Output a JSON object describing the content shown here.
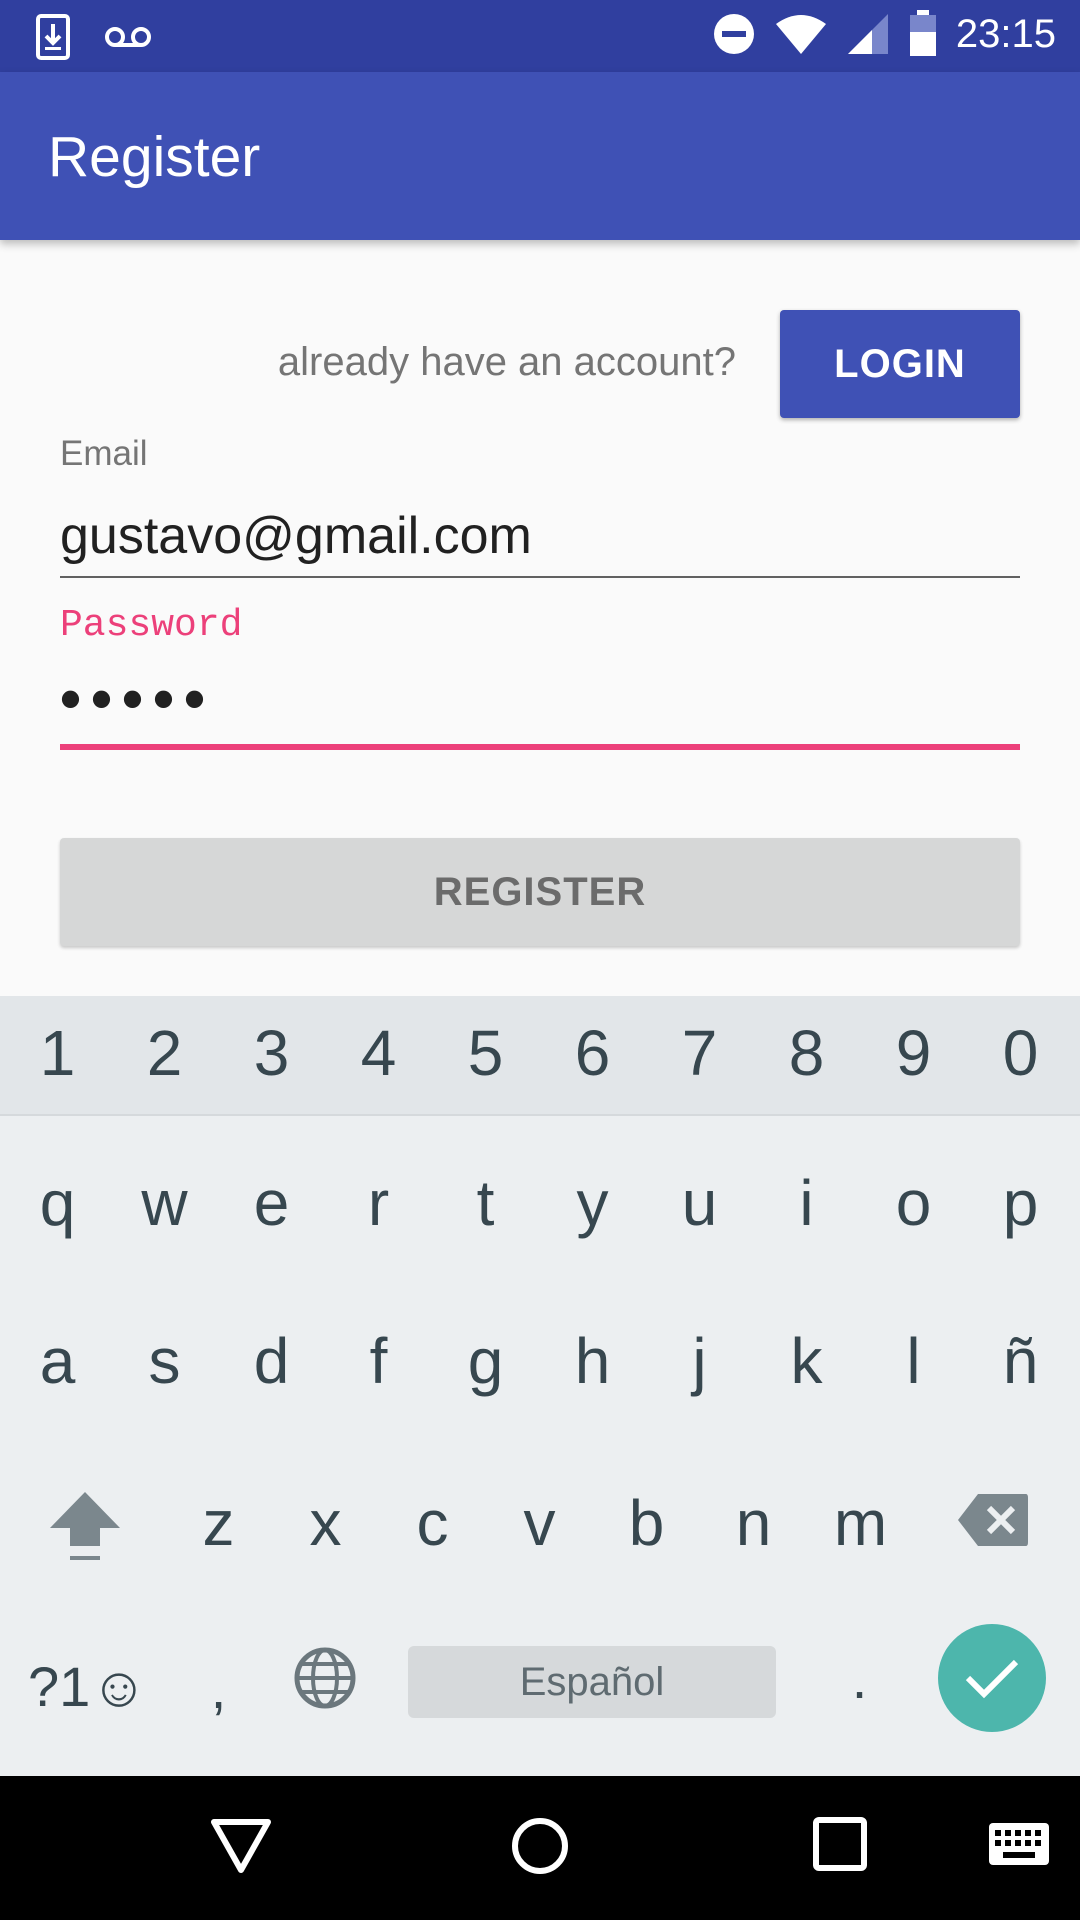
{
  "status_bar": {
    "time": "23:15",
    "icons": [
      "download-icon",
      "voicemail-icon",
      "do-not-disturb-icon",
      "wifi-icon",
      "signal-icon",
      "battery-icon"
    ]
  },
  "app_bar": {
    "title": "Register"
  },
  "form": {
    "already_text": "already have an account?",
    "login_label": "LOGIN",
    "email_label": "Email",
    "email_value": "gustavo@gmail.com",
    "password_label": "Password",
    "password_value": "•••••",
    "register_label": "REGISTER"
  },
  "keyboard": {
    "number_row": [
      "1",
      "2",
      "3",
      "4",
      "5",
      "6",
      "7",
      "8",
      "9",
      "0"
    ],
    "row1": [
      "q",
      "w",
      "e",
      "r",
      "t",
      "y",
      "u",
      "i",
      "o",
      "p"
    ],
    "row2": [
      "a",
      "s",
      "d",
      "f",
      "g",
      "h",
      "j",
      "k",
      "l",
      "ñ"
    ],
    "row3": [
      "z",
      "x",
      "c",
      "v",
      "b",
      "n",
      "m"
    ],
    "symbols_label": "?1☺",
    "comma": ",",
    "period": ".",
    "space_label": "Español"
  },
  "colors": {
    "primary": "#3f51b5",
    "primary_dark": "#303f9f",
    "accent": "#ec407a",
    "enter_key": "#4db6ac"
  }
}
